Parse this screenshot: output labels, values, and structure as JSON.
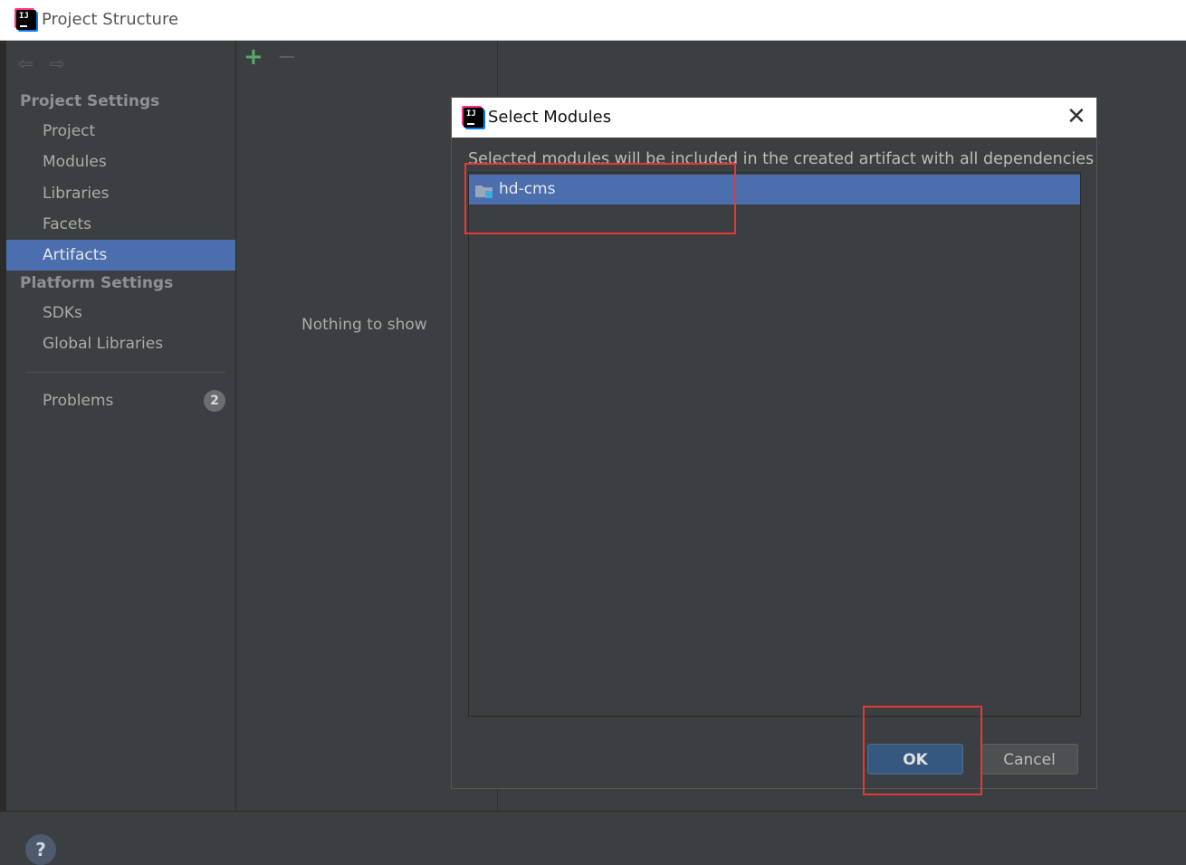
{
  "window": {
    "title": "Project Structure"
  },
  "sidebar": {
    "project_settings_header": "Project Settings",
    "project_items": [
      {
        "label": "Project",
        "selected": false
      },
      {
        "label": "Modules",
        "selected": false
      },
      {
        "label": "Libraries",
        "selected": false
      },
      {
        "label": "Facets",
        "selected": false
      },
      {
        "label": "Artifacts",
        "selected": true
      }
    ],
    "platform_settings_header": "Platform Settings",
    "platform_items": [
      {
        "label": "SDKs"
      },
      {
        "label": "Global Libraries"
      }
    ],
    "problems": {
      "label": "Problems",
      "count": "2"
    }
  },
  "artifacts_panel": {
    "add_label": "+",
    "remove_label": "−",
    "empty_text": "Nothing to show"
  },
  "dialog": {
    "title": "Select Modules",
    "description": "Selected modules will be included in the created artifact with all dependencies",
    "modules": [
      {
        "label": "hd-cms",
        "selected": true
      }
    ],
    "ok_label": "OK",
    "cancel_label": "Cancel",
    "close_label": "✕"
  },
  "footer": {
    "help_label": "?"
  },
  "colors": {
    "background": "#3c3f41",
    "selection": "#4b6eaf",
    "default_button": "#365880",
    "highlight": "#e53935"
  }
}
